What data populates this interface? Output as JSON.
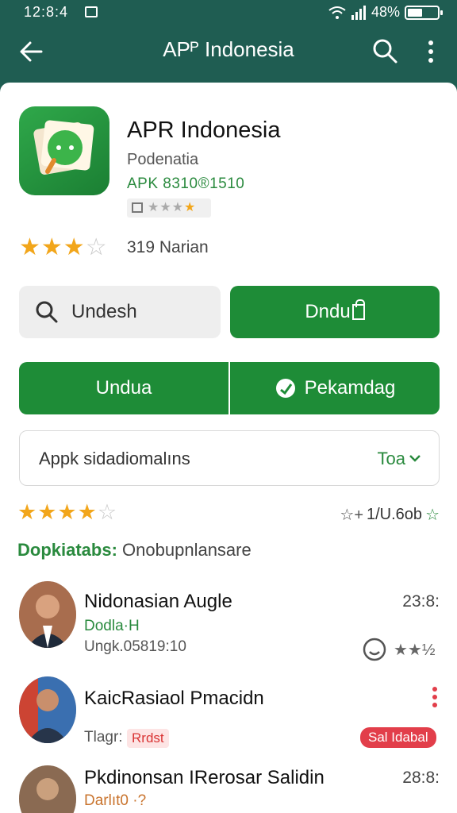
{
  "status": {
    "time": "12:8:4",
    "battery": "48%"
  },
  "appbar": {
    "title": "APᴾ Indonesia"
  },
  "app": {
    "name": "APR Indonesia",
    "developer": "Podenatia",
    "apk": "APK 8310®1510",
    "rating_count": "319 Narian"
  },
  "actions": {
    "search_label": "Undesh",
    "download_label": "Dndu",
    "unduh_label": "Undua",
    "permission_label": "Pekamdag"
  },
  "select": {
    "label": "Appk sidadiomalıns",
    "value": "Toa"
  },
  "ratings": {
    "right_value": "1/U.6ob"
  },
  "section": {
    "bold": "Dopkiatabs:",
    "rest": "Onobupnlansare"
  },
  "items": [
    {
      "name": "Nidonasian Augle",
      "sub1": "Dodla·H",
      "sub2": "Ungk.05819:10",
      "time": "23:8:",
      "right_text": "★★½"
    },
    {
      "name": "KaicRasiaol Pmacidn",
      "sub1": "",
      "sub2": "Tlagr:",
      "badge": "Rrdst",
      "pill": "Sal Idabal"
    },
    {
      "name": "Pkdinonsan IRerosar Salidin",
      "sub1": "Darlıt0 ·?",
      "time": "28:8:"
    }
  ],
  "colors": {
    "primary": "#1f5d52",
    "accent": "#1e8c37",
    "star": "#f2a61b",
    "danger": "#e23e4a"
  }
}
